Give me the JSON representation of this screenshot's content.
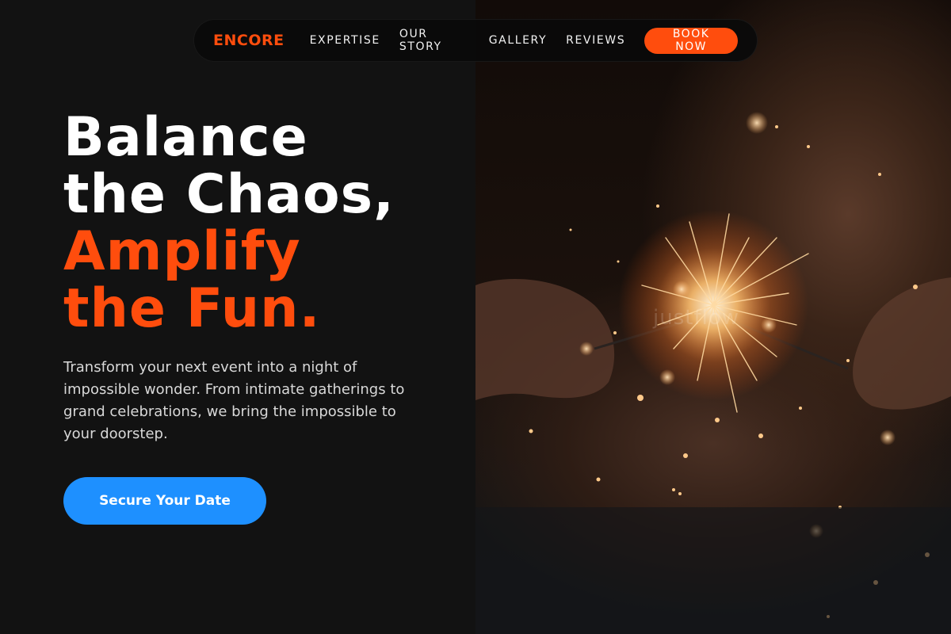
{
  "nav": {
    "brand": "ENCORE",
    "links": [
      "EXPERTISE",
      "OUR STORY",
      "GALLERY",
      "REVIEWS"
    ],
    "book_label": "BOOK NOW"
  },
  "hero": {
    "title_lines": [
      "Balance",
      "the Chaos,"
    ],
    "accent_lines": [
      "Amplify",
      "the Fun."
    ],
    "description": "Transform your next event into a night of impossible wonder. From intimate gatherings to grand celebrations, we bring the impossible to your doorstep.",
    "cta_label": "Secure Your Date"
  },
  "photo": {
    "subject": "hands holding a lit sparkler",
    "watermark": "justflow"
  },
  "colors": {
    "accent": "#ff4d0d",
    "cta": "#1e90ff",
    "background": "#121212"
  }
}
